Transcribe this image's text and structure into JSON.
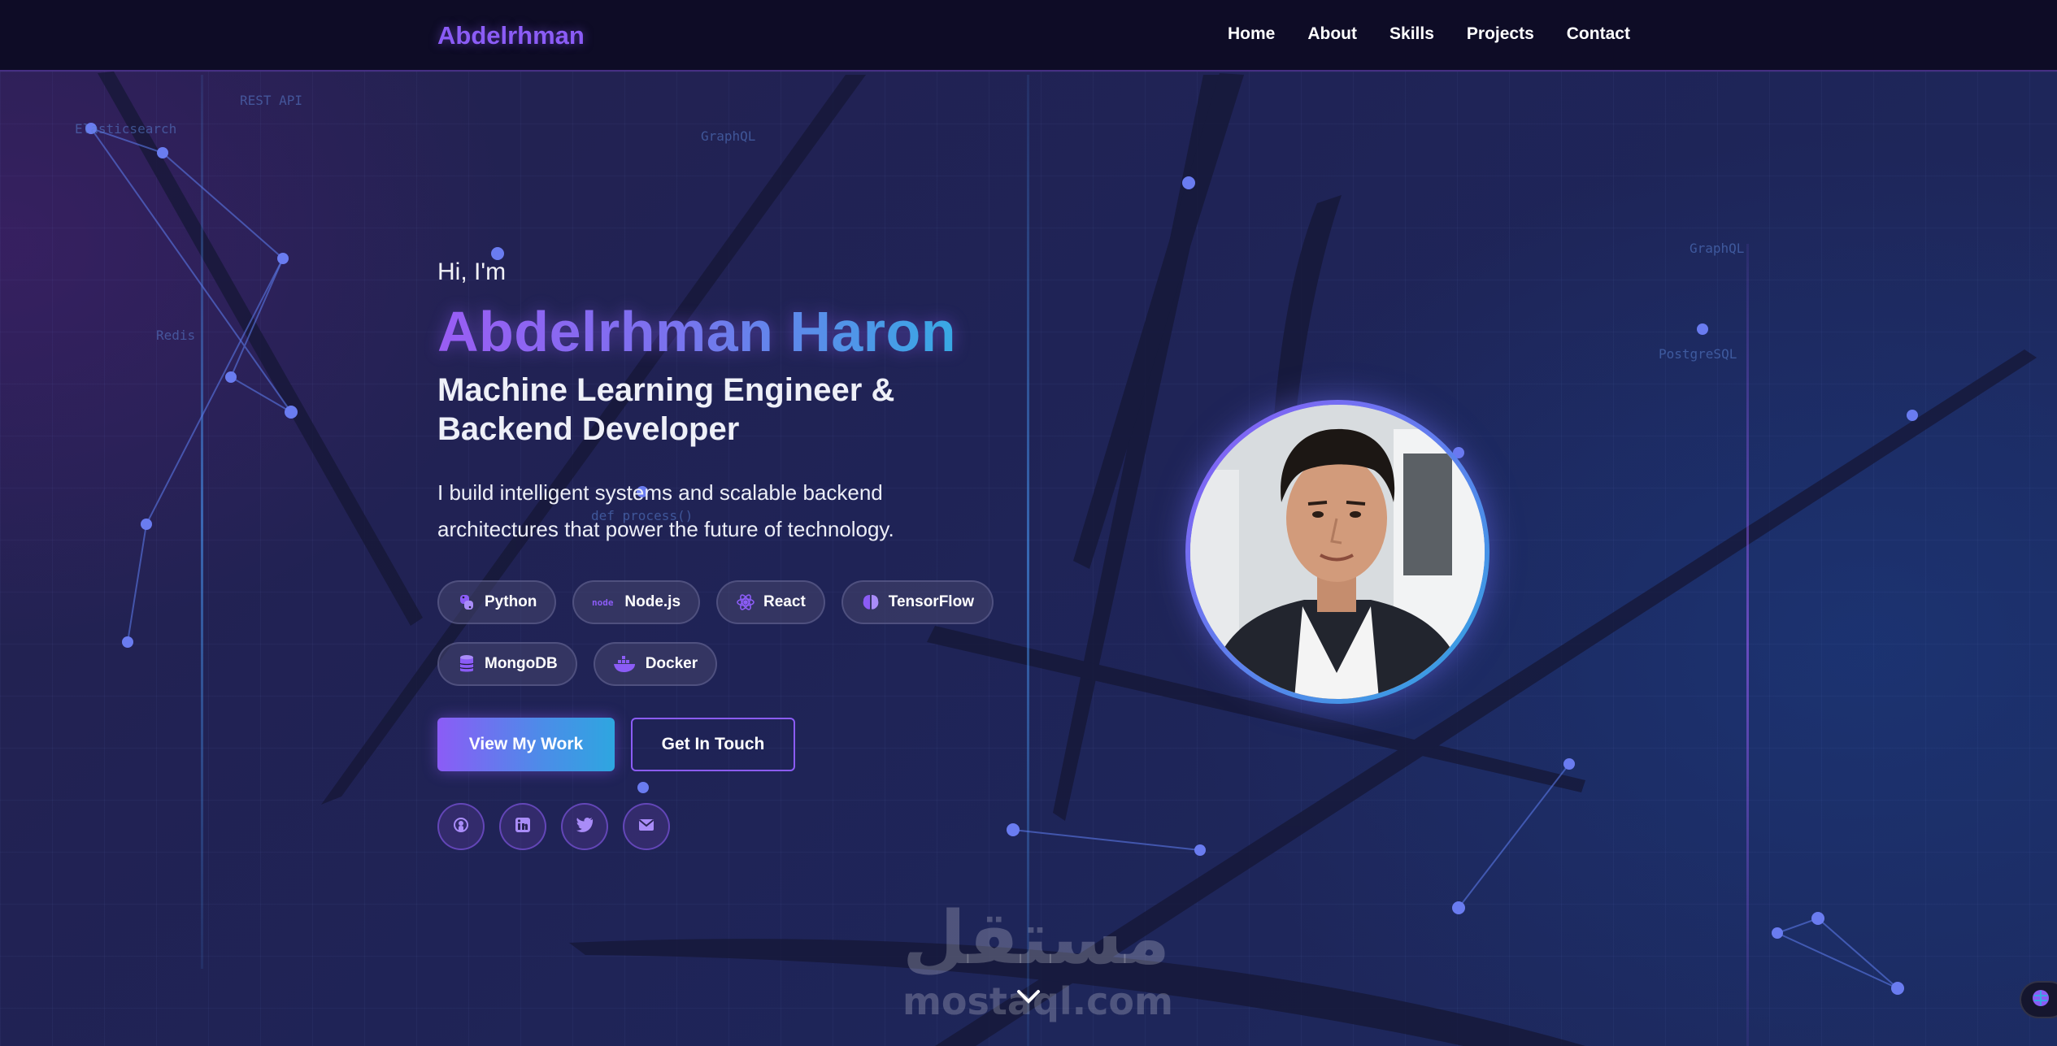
{
  "nav": {
    "brand": "Abdelrhman",
    "links": [
      "Home",
      "About",
      "Skills",
      "Projects",
      "Contact"
    ]
  },
  "hero": {
    "greeting": "Hi, I'm",
    "name": "Abdelrhman Haron",
    "title_line1": "Machine Learning Engineer &",
    "title_line2": "Backend Developer",
    "description_line1": "I build intelligent systems and scalable backend",
    "description_line2": "architectures that power the future of technology."
  },
  "tags": [
    {
      "label": "Python",
      "icon": "python-icon"
    },
    {
      "label": "Node.js",
      "icon": "nodejs-icon"
    },
    {
      "label": "React",
      "icon": "react-icon"
    },
    {
      "label": "TensorFlow",
      "icon": "brain-icon"
    },
    {
      "label": "MongoDB",
      "icon": "database-icon"
    },
    {
      "label": "Docker",
      "icon": "docker-icon"
    }
  ],
  "buttons": {
    "primary": "View My Work",
    "secondary": "Get In Touch"
  },
  "socials": [
    "github-icon",
    "linkedin-icon",
    "twitter-icon",
    "email-icon"
  ],
  "background_labels": [
    "REST API",
    "Elasticsearch",
    "GraphQL",
    "Redis",
    "def process()",
    "GraphQL",
    "PostgreSQL"
  ],
  "watermark": {
    "arabic": "مستقل",
    "latin": "mostaql.com"
  },
  "colors": {
    "accent_purple": "#8b5cf6",
    "accent_blue": "#2ea6e0",
    "nav_bg": "#0e0c26"
  }
}
